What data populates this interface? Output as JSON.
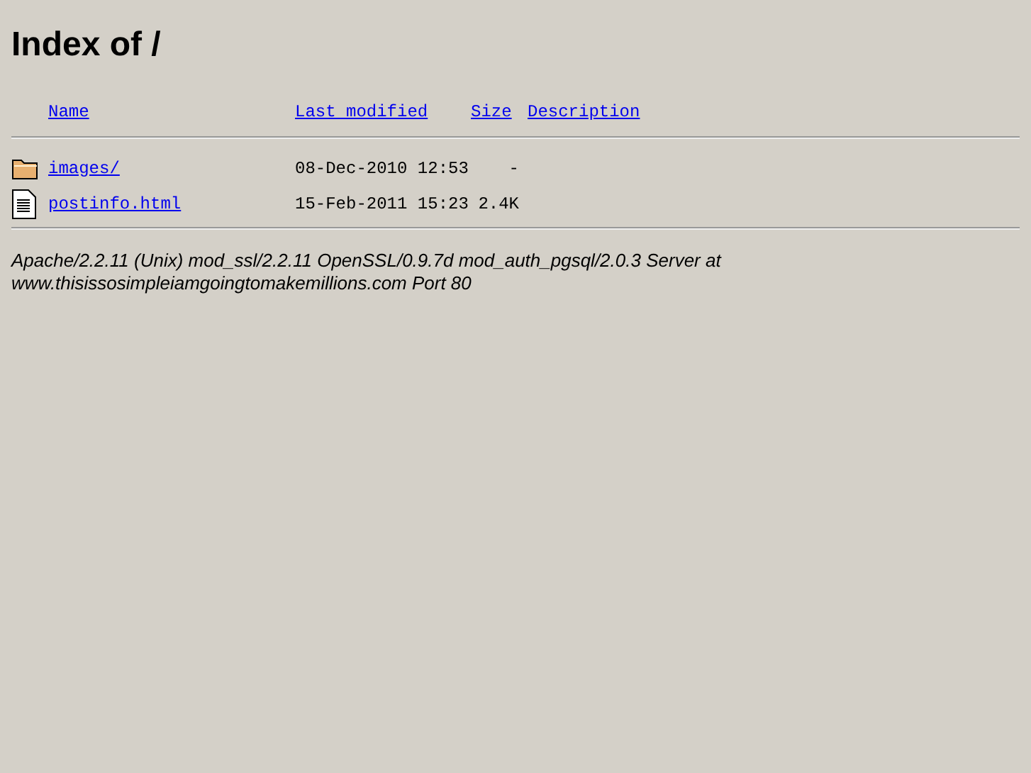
{
  "title": "Index of /",
  "columns": [
    "Name",
    "Last modified",
    "Size",
    "Description"
  ],
  "rows": [
    {
      "kind": "folder",
      "name": "images/",
      "modified": "08-Dec-2010 12:53",
      "size": "-"
    },
    {
      "kind": "file",
      "name": "postinfo.html",
      "modified": "15-Feb-2011 15:23",
      "size": "2.4K"
    }
  ],
  "address": "Apache/2.2.11 (Unix) mod_ssl/2.2.11 OpenSSL/0.9.7d mod_auth_pgsql/2.0.3 Server at www.thisissosimpleiamgoingtomakemillions.com Port 80"
}
